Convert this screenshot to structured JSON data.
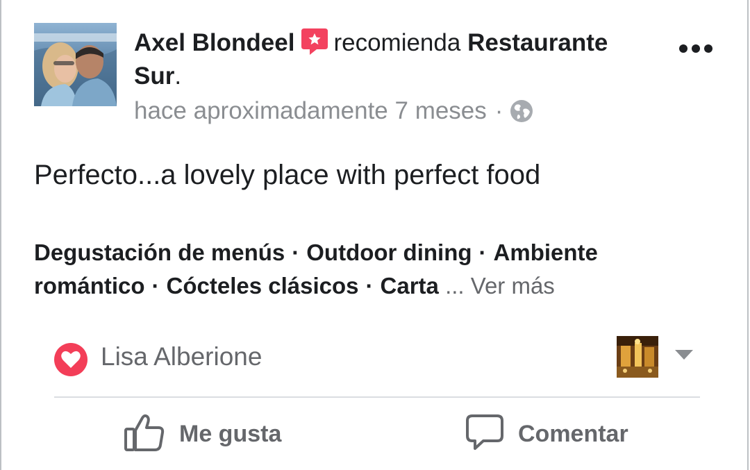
{
  "post": {
    "author": "Axel Blondeel",
    "verb": "recomienda",
    "page": "Restaurante Sur",
    "trailing_period": ".",
    "time": "hace aproximadamente 7 meses",
    "meta_separator": "·",
    "audience_icon": "globe-icon",
    "recommendation_icon": "star-speech-bubble-icon",
    "more_icon": "more-horizontal-icon",
    "text": "Perfecto...a lovely place with perfect food",
    "tags": [
      "Degustación de menús",
      "Outdoor dining",
      "Ambiente romántico",
      "Cócteles clásicos",
      "Carta"
    ],
    "tag_separator": "·",
    "see_more": "... Ver más"
  },
  "reactions": {
    "icon": "heart-reaction-icon",
    "name": "Lisa Alberione",
    "dropdown_icon": "caret-down-icon"
  },
  "actions": {
    "like_label": "Me gusta",
    "like_icon": "thumbs-up-icon",
    "comment_label": "Comentar",
    "comment_icon": "comment-bubble-icon"
  },
  "colors": {
    "recommend_accent": "#f3425f",
    "heart": "#f33e58",
    "muted_text": "#65676b",
    "meta_text": "#8a8d91",
    "divider": "#dadde1"
  }
}
